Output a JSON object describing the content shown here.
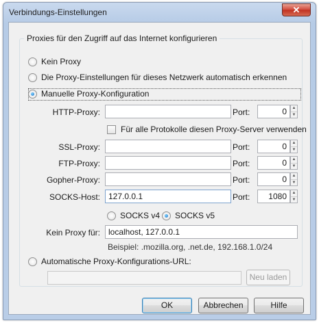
{
  "window": {
    "title": "Verbindungs-Einstellungen",
    "close_glyph": "✕"
  },
  "group": {
    "legend": "Proxies für den Zugriff auf das Internet konfigurieren"
  },
  "options": {
    "no_proxy": "Kein Proxy",
    "auto_detect": "Die Proxy-Einstellungen für dieses Netzwerk automatisch erkennen",
    "manual": "Manuelle Proxy-Konfiguration",
    "auto_url": "Automatische Proxy-Konfigurations-URL:",
    "selected": "manual"
  },
  "manual": {
    "http_label": "HTTP-Proxy:",
    "http_value": "",
    "http_port_label": "Port:",
    "http_port": "0",
    "same_proxy_label": "Für alle Protokolle diesen Proxy-Server verwenden",
    "same_proxy_checked": false,
    "ssl_label": "SSL-Proxy:",
    "ssl_value": "",
    "ssl_port_label": "Port:",
    "ssl_port": "0",
    "ftp_label": "FTP-Proxy:",
    "ftp_value": "",
    "ftp_port_label": "Port:",
    "ftp_port": "0",
    "gopher_label": "Gopher-Proxy:",
    "gopher_value": "",
    "gopher_port_label": "Port:",
    "gopher_port": "0",
    "socks_label": "SOCKS-Host:",
    "socks_value": "127.0.0.1",
    "socks_port_label": "Port:",
    "socks_port": "1080",
    "socks_v4": "SOCKS v4",
    "socks_v5": "SOCKS v5",
    "socks_selected": "v5",
    "no_proxy_for_label": "Kein Proxy für:",
    "no_proxy_for_value": "localhost, 127.0.0.1",
    "example": "Beispiel: .mozilla.org, .net.de, 192.168.1.0/24"
  },
  "auto": {
    "url_value": "",
    "reload_label": "Neu laden"
  },
  "footer": {
    "ok": "OK",
    "cancel": "Abbrechen",
    "help": "Hilfe"
  },
  "icons": {
    "spinner_up": "▲",
    "spinner_down": "▼"
  },
  "colors": {
    "titlebar": "#b9cde7",
    "close_button": "#c0301f",
    "dialog_bg": "#f0f0f0",
    "radio_dot": "#1d6ec4"
  }
}
